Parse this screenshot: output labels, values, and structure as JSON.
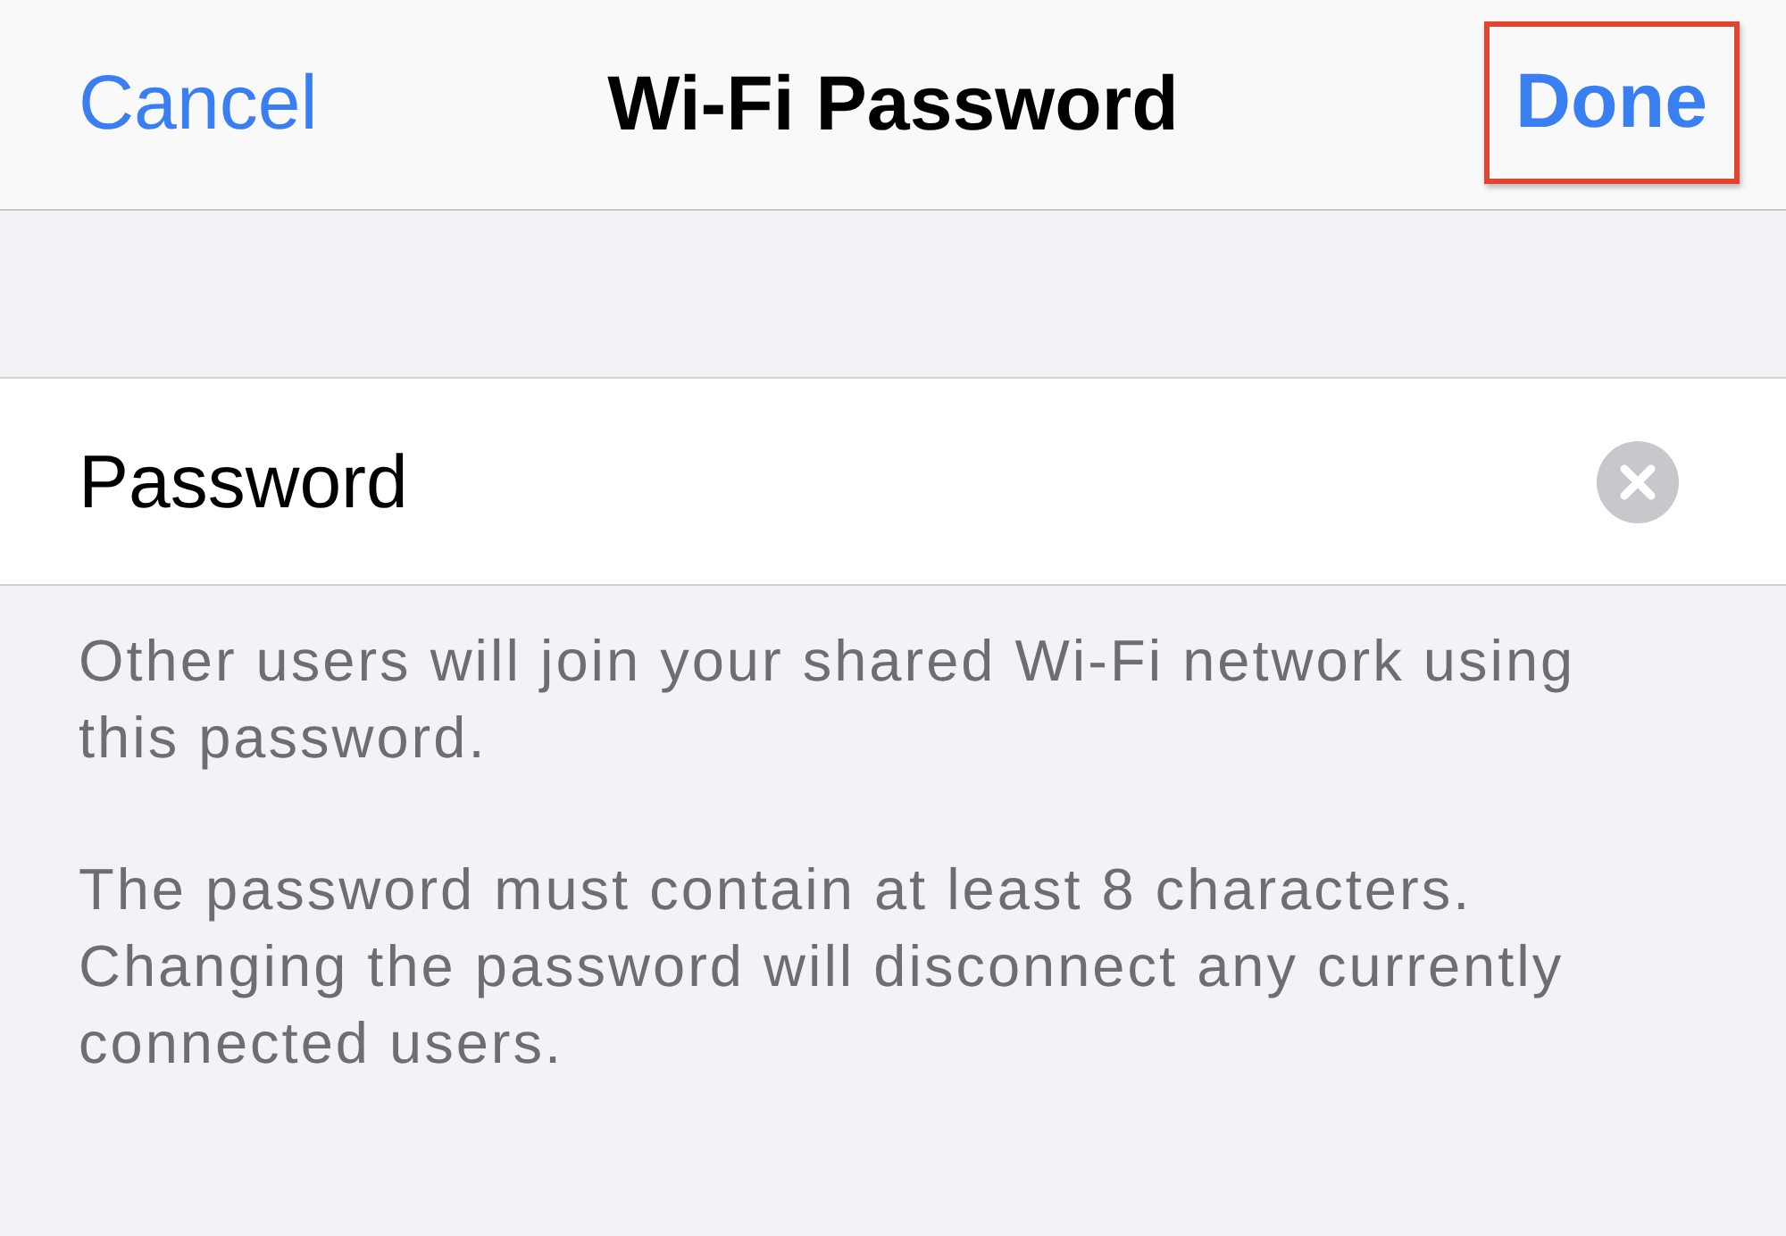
{
  "nav_bar": {
    "cancel_button": {
      "label": "Cancel"
    },
    "title": "Wi-Fi Password",
    "done_button": {
      "label": "Done",
      "highlighted": true
    }
  },
  "password_field": {
    "value": "Password",
    "clear_button": true
  },
  "footer_notes": [
    "Other users will join your shared Wi-Fi network using this password.",
    "The password must contain at least 8 characters. Changing the password will disconnect any currently connected users."
  ]
}
